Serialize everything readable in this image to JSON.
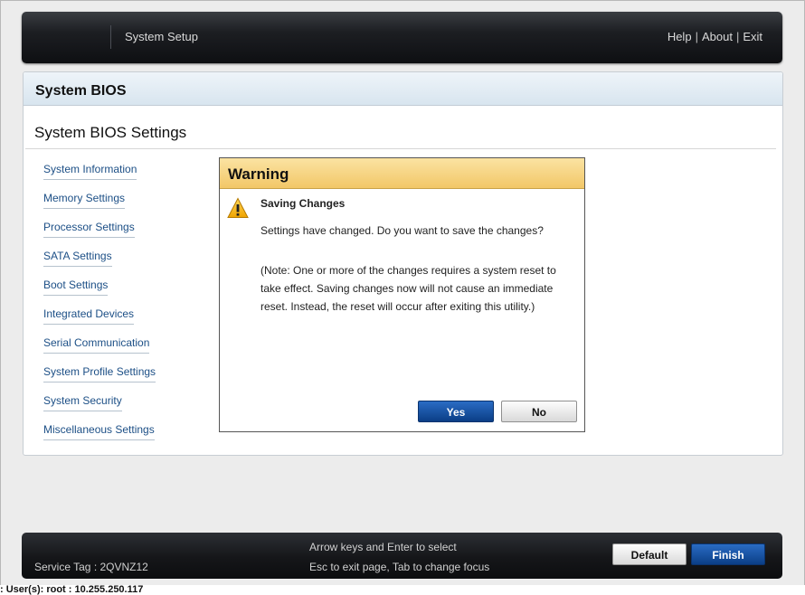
{
  "header": {
    "app_title": "System Setup",
    "help_label": "Help",
    "about_label": "About",
    "exit_label": "Exit",
    "separator": "|"
  },
  "panel": {
    "section_title": "System BIOS",
    "page_title": "System BIOS Settings"
  },
  "nav": {
    "items": [
      {
        "label": "System Information"
      },
      {
        "label": "Memory Settings"
      },
      {
        "label": "Processor Settings"
      },
      {
        "label": "SATA Settings"
      },
      {
        "label": "Boot Settings"
      },
      {
        "label": "Integrated Devices"
      },
      {
        "label": "Serial Communication"
      },
      {
        "label": "System Profile Settings"
      },
      {
        "label": "System Security"
      },
      {
        "label": "Miscellaneous Settings"
      }
    ]
  },
  "dialog": {
    "title": "Warning",
    "icon": "warning-triangle-icon",
    "subtitle": "Saving Changes",
    "message": "Settings have changed. Do you want to save the changes?",
    "note": "(Note: One or more of the changes requires a system reset to take effect. Saving changes now will not cause an immediate reset. Instead, the reset will occur after exiting this utility.)",
    "yes_label": "Yes",
    "no_label": "No"
  },
  "footer": {
    "service_tag": "Service Tag : 2QVNZ12",
    "hint_line1": "Arrow keys and Enter to select",
    "hint_line2": "Esc to exit page, Tab to change focus",
    "default_label": "Default",
    "finish_label": "Finish"
  },
  "statusline": {
    "text": ": User(s): root : 10.255.250.117"
  },
  "colors": {
    "link": "#1c4f86",
    "primary_button": "#0b3e86",
    "warning_header": "#f2c768",
    "header_bg": "#1c1e22"
  }
}
